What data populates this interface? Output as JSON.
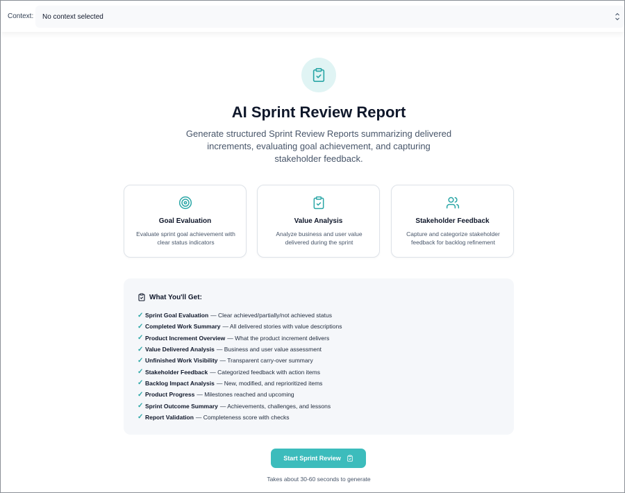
{
  "context": {
    "label": "Context:",
    "selected": "No context selected"
  },
  "hero": {
    "icon": "clipboard-check-icon",
    "title": "AI Sprint Review Report",
    "subtitle": "Generate structured Sprint Review Reports summarizing delivered increments, evaluating goal achievement, and capturing stakeholder feedback."
  },
  "features": [
    {
      "icon": "target-icon",
      "title": "Goal Evaluation",
      "description": "Evaluate sprint goal achievement with clear status indicators"
    },
    {
      "icon": "clipboard-check-icon",
      "title": "Value Analysis",
      "description": "Analyze business and user value delivered during the sprint"
    },
    {
      "icon": "users-icon",
      "title": "Stakeholder Feedback",
      "description": "Capture and categorize stakeholder feedback for backlog refinement"
    }
  ],
  "deliverables": {
    "heading": "What You'll Get:",
    "items": [
      {
        "title": "Sprint Goal Evaluation",
        "detail": "— Clear achieved/partially/not achieved status"
      },
      {
        "title": "Completed Work Summary",
        "detail": "— All delivered stories with value descriptions"
      },
      {
        "title": "Product Increment Overview",
        "detail": "— What the product increment delivers"
      },
      {
        "title": "Value Delivered Analysis",
        "detail": "— Business and user value assessment"
      },
      {
        "title": "Unfinished Work Visibility",
        "detail": "— Transparent carry-over summary"
      },
      {
        "title": "Stakeholder Feedback",
        "detail": "— Categorized feedback with action items"
      },
      {
        "title": "Backlog Impact Analysis",
        "detail": "— New, modified, and reprioritized items"
      },
      {
        "title": "Product Progress",
        "detail": "— Milestones reached and upcoming"
      },
      {
        "title": "Sprint Outcome Summary",
        "detail": "— Achievements, challenges, and lessons"
      },
      {
        "title": "Report Validation",
        "detail": "— Completeness score with checks"
      }
    ]
  },
  "cta": {
    "label": "Start Sprint Review",
    "note": "Takes about 30-60 seconds to generate"
  },
  "colors": {
    "accent": "#3cbcbc",
    "accent_dark": "#2aa6a6",
    "icon_bg": "#e0f4f4"
  }
}
